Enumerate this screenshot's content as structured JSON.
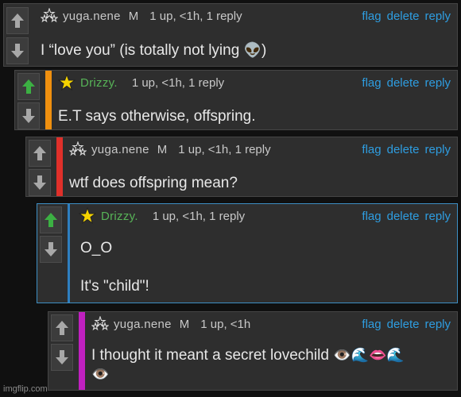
{
  "actions": {
    "flag": "flag",
    "delete": "delete",
    "reply": "reply"
  },
  "comments": [
    {
      "username": "yuga.nene",
      "gender": "M",
      "meta": "1 up, <1h, 1 reply",
      "text": "I “love you” (is totally not lying ",
      "text_end": ")",
      "emoji": "👽"
    },
    {
      "username": "Drizzy.",
      "meta": "1 up, <1h, 1 reply",
      "text": "E.T says otherwise, offspring."
    },
    {
      "username": "yuga.nene",
      "gender": "M",
      "meta": "1 up, <1h, 1 reply",
      "text": "wtf does offspring mean?"
    },
    {
      "username": "Drizzy.",
      "meta": "1 up, <1h, 1 reply",
      "text_line1": "O_O",
      "text_line2": "It's \"child\"!"
    },
    {
      "username": "yuga.nene",
      "gender": "M",
      "meta": "1 up, <1h",
      "text_line1": "I thought it meant a secret lovechild ",
      "emojis_line1": "👁️🌊👄🌊",
      "emojis_line2": "👁️"
    }
  ],
  "footer": "imgflip.com",
  "colors": {
    "stripe_orange": "#f0900f",
    "stripe_red": "#e0302a",
    "stripe_blue": "#2e7fc0",
    "stripe_magenta": "#c020c0",
    "link_blue": "#2e9de0",
    "upvote_green": "#3cb043",
    "username_green": "#57b357"
  }
}
